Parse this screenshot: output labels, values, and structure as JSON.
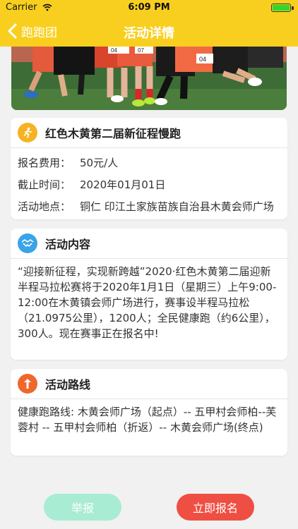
{
  "status_bar": {
    "carrier": "Carrier",
    "time": "6:09 PM"
  },
  "nav": {
    "back_label": "跑跑团",
    "title": "活动详情"
  },
  "event": {
    "name": "红色木黄第二届新征程慢跑",
    "fee_label": "报名费用：",
    "fee_value": "50元/人",
    "deadline_label": "截止时间：",
    "deadline_value": "2020年01月01日",
    "location_label": "活动地点：",
    "location_value": "铜仁 印江土家族苗族自治县木黄会师广场"
  },
  "content": {
    "title": "活动内容",
    "text": "“迎接新征程，实现新跨越”2020·红色木黄第二届迎新半程马拉松赛将于2020年1月1日（星期三）上午9:00-12:00在木黄镇会师广场进行，赛事设半程马拉松（21.0975公里），1200人；全民健康跑（约6公里），300人。现在赛事正在报名中!"
  },
  "route": {
    "title": "活动路线",
    "text": "健康跑路线: 木黄会师广场（起点）-- 五甲村会师柏--芙蓉村 -- 五甲村会师柏（折返）-- 木黄会师广场(终点)"
  },
  "actions": {
    "report_label": "举报",
    "signup_label": "立即报名"
  },
  "colors": {
    "nav_background": "#f9cf1f",
    "runner_icon": "#f7b223",
    "content_icon": "#3aa3ea",
    "route_icon": "#f0672b",
    "report_button": "#a7ecd3",
    "signup_button": "#ef4f43"
  },
  "icons": {
    "back": "chevron-left-icon",
    "wifi": "wifi-icon",
    "battery": "battery-icon",
    "event": "runner-icon",
    "content": "handshake-icon",
    "route": "route-arrow-icon"
  },
  "photo_runner_bibs": [
    "04",
    "07",
    "04"
  ]
}
